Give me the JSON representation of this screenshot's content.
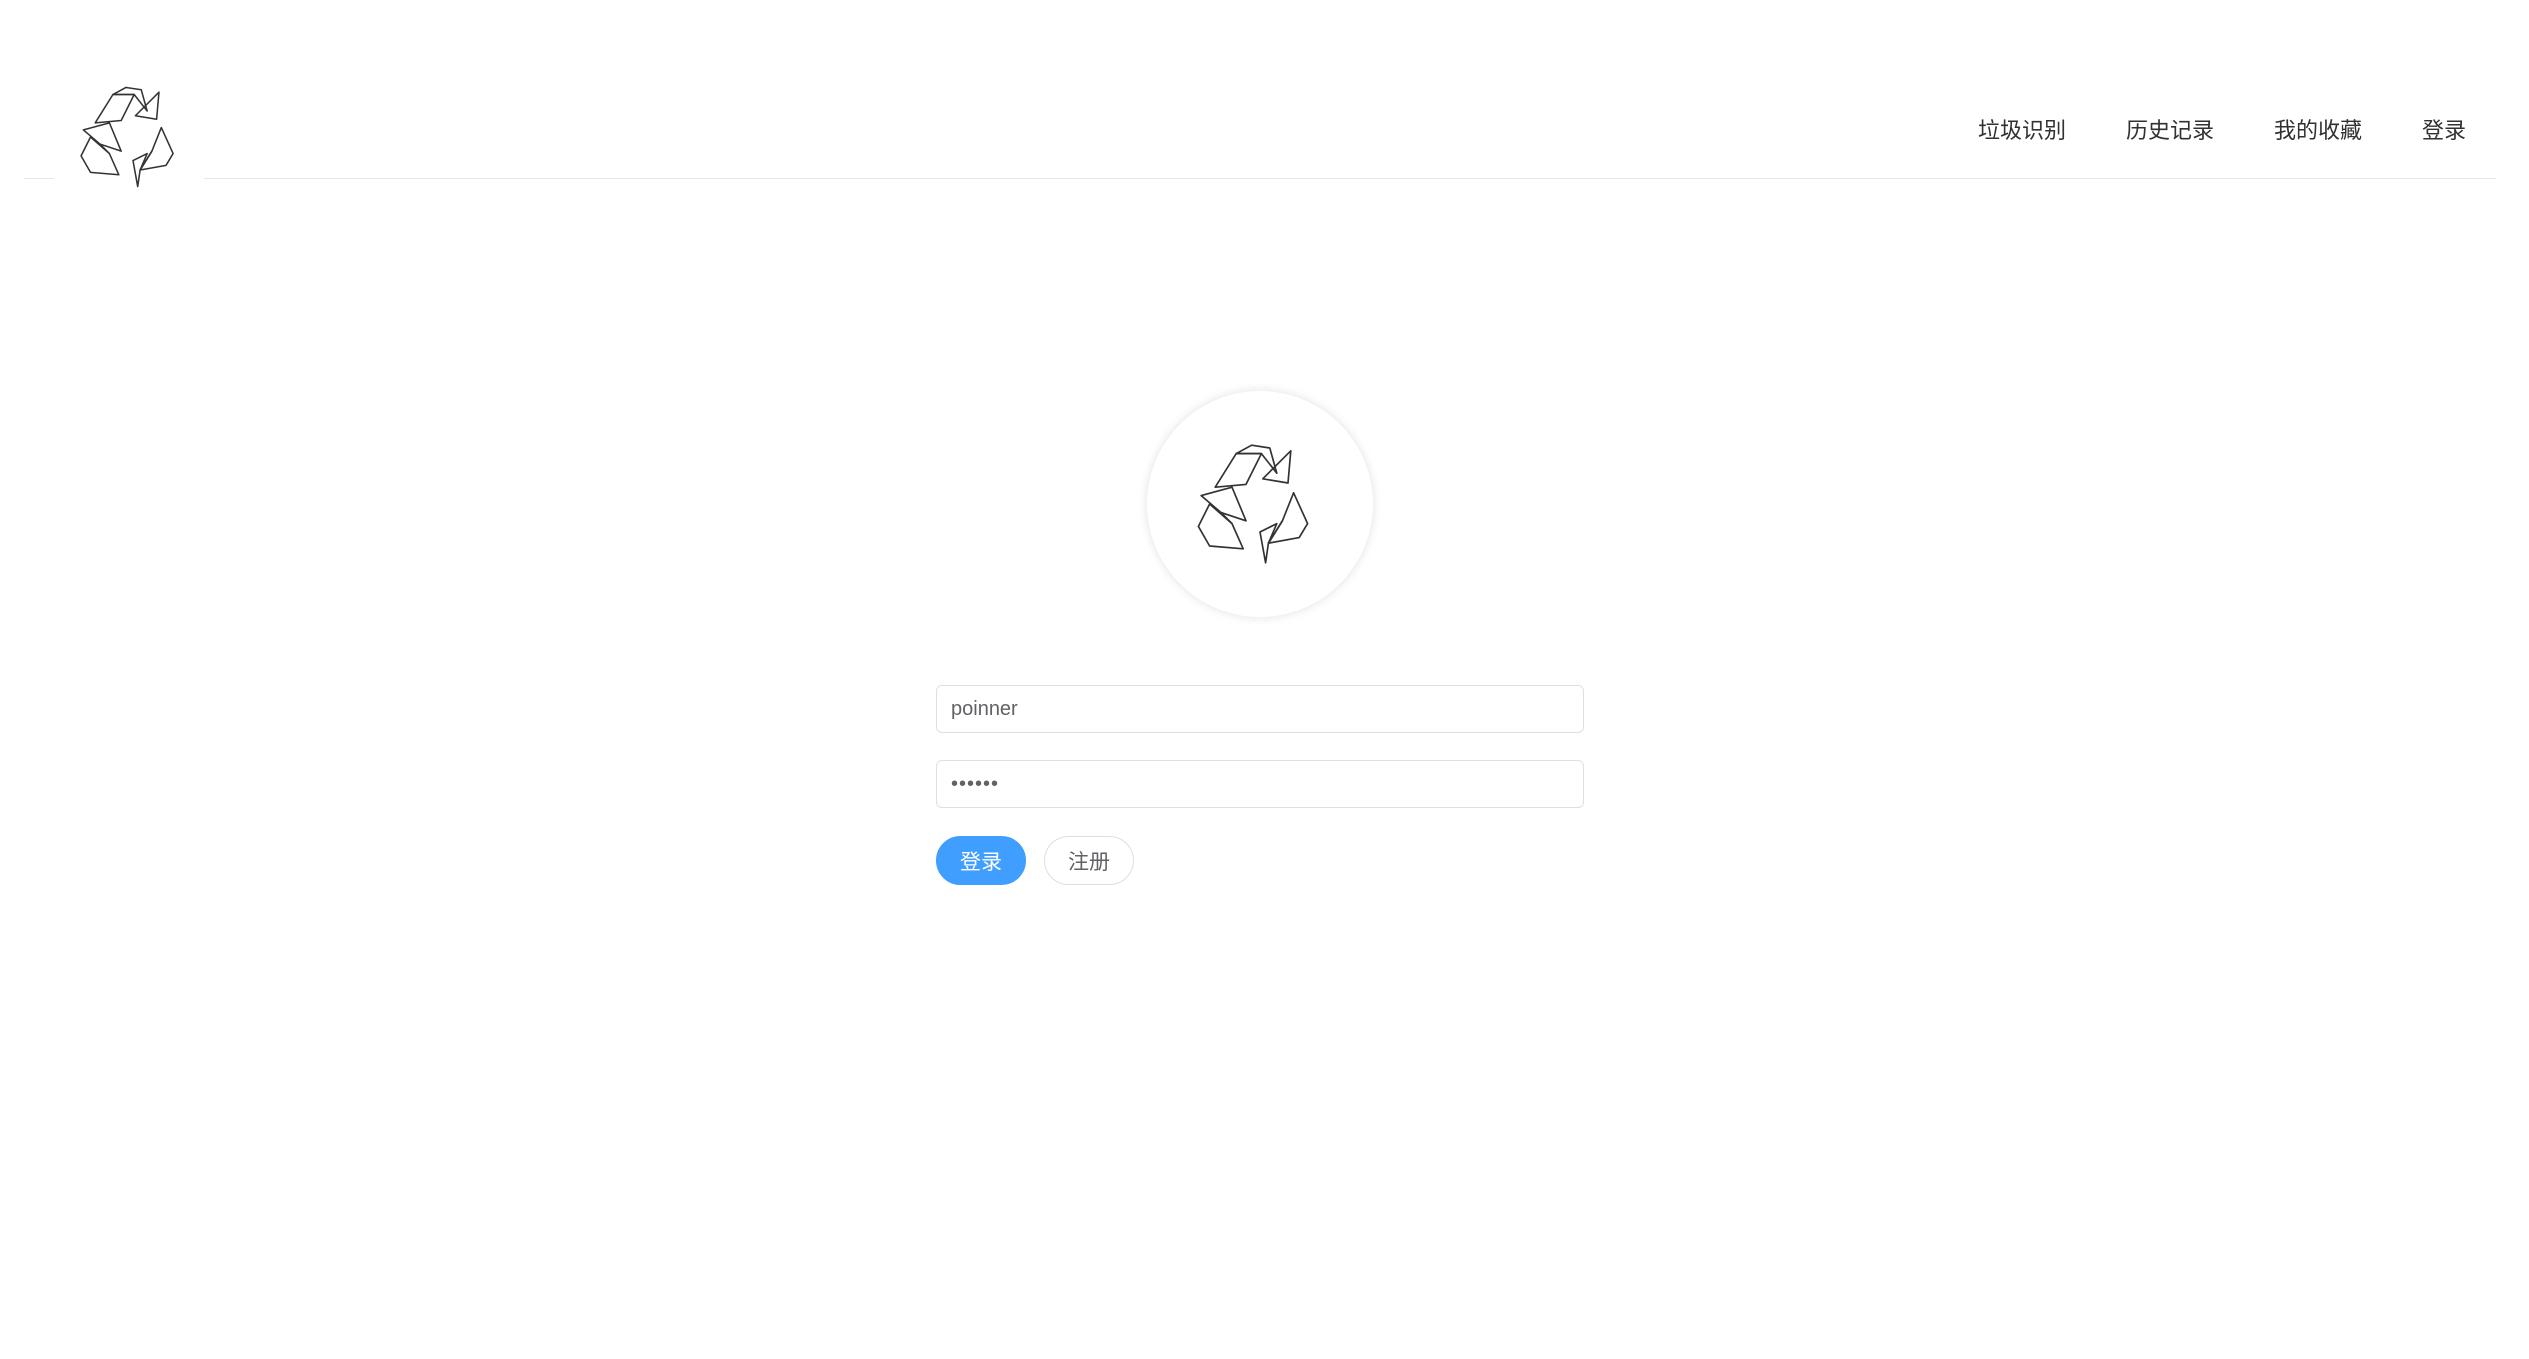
{
  "header": {
    "logo_icon": "recycle-icon",
    "nav": [
      {
        "label": "垃圾识别"
      },
      {
        "label": "历史记录"
      },
      {
        "label": "我的收藏"
      },
      {
        "label": "登录"
      }
    ]
  },
  "avatar": {
    "icon": "recycle-icon"
  },
  "form": {
    "username_value": "poinner",
    "password_value": "••••••",
    "login_label": "登录",
    "register_label": "注册"
  },
  "colors": {
    "primary": "#409eff",
    "border": "#dcdfe6",
    "text": "#303133"
  }
}
